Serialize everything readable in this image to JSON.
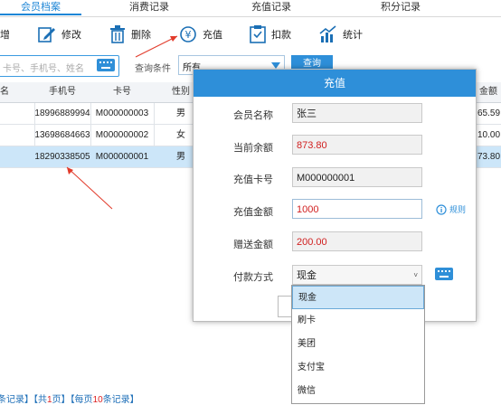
{
  "tabs": [
    "会员档案",
    "消费记录",
    "充值记录",
    "积分记录"
  ],
  "toolbar": {
    "add": "增",
    "edit": "修改",
    "delete": "删除",
    "recharge": "充值",
    "deduct": "扣款",
    "stats": "统计"
  },
  "search": {
    "placeholder": "卡号、手机号、姓名",
    "condition_label": "查询条件",
    "condition_value": "所有",
    "query_button": "查询"
  },
  "table": {
    "headers": [
      "名",
      "手机号",
      "卡号",
      "性别",
      "金额"
    ],
    "rows": [
      {
        "phone": "18996889994",
        "card": "M000000003",
        "gender": "男",
        "amount": "65.59"
      },
      {
        "phone": "13698684663",
        "card": "M000000002",
        "gender": "女",
        "amount": "10.00"
      },
      {
        "phone": "18290338505",
        "card": "M000000001",
        "gender": "男",
        "amount": "73.80"
      }
    ]
  },
  "pager": {
    "prefix": "条记录】",
    "total_open": "【共",
    "total_pages": "1",
    "total_close": "页】",
    "per_open": "【每页",
    "per_count": "10",
    "per_close": "条记录】"
  },
  "dialog": {
    "title": "充值",
    "fields": {
      "member_name": {
        "label": "会员名称",
        "value": "张三"
      },
      "balance": {
        "label": "当前余额",
        "value": "873.80"
      },
      "card_no": {
        "label": "充值卡号",
        "value": "M000000001"
      },
      "amount": {
        "label": "充值金额",
        "value": "1000"
      },
      "bonus": {
        "label": "赠送金额",
        "value": "200.00"
      },
      "payment": {
        "label": "付款方式",
        "value": "现金"
      }
    },
    "rule_link": "规则"
  },
  "payment_options": [
    "现金",
    "刷卡",
    "美团",
    "支付宝",
    "微信"
  ],
  "colors": {
    "accent": "#2e8fd9",
    "selected_row": "#cce6f9",
    "value_red": "#d12020"
  }
}
